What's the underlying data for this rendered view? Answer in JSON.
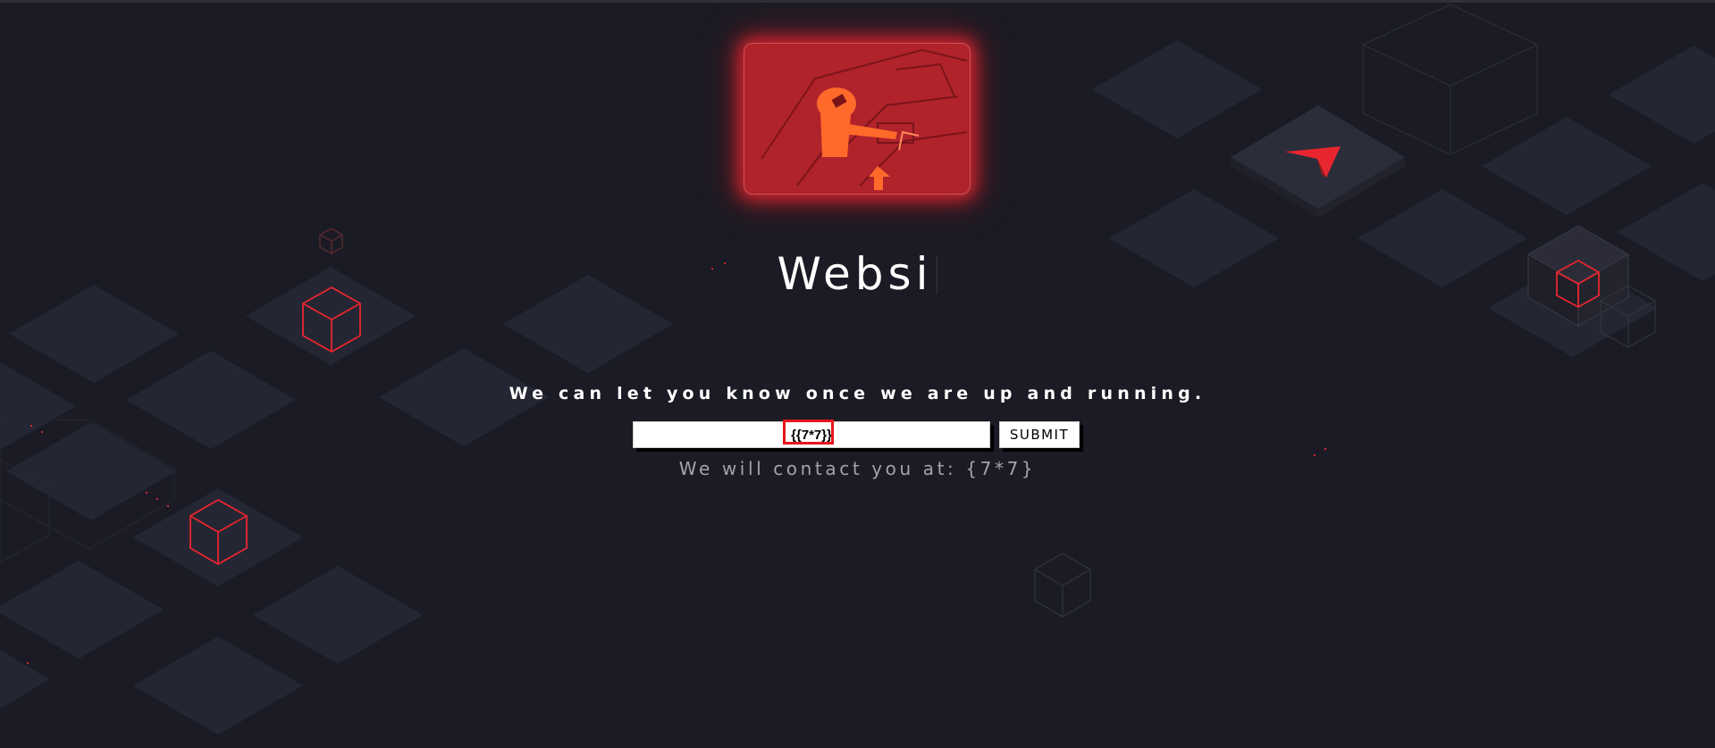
{
  "page": {
    "title": "Websi",
    "tagline": "We can let you know once we are up and running.",
    "contact_note": "We will contact you at: {7*7}"
  },
  "signup_form": {
    "email_value": "{{7*7}}",
    "submit_label": "SUBMIT"
  },
  "colors": {
    "background": "#1a1b24",
    "tile": "#252633",
    "accent_red": "#e8262f",
    "hero_red": "#b0232b",
    "hero_orange": "#ff6a2a",
    "muted_text": "#a3a3a8"
  },
  "icons": {
    "logo": "red-arrowhead-logo-icon",
    "decor": "isometric-cube-icon",
    "hero": "astronaut-pointing-illustration"
  }
}
